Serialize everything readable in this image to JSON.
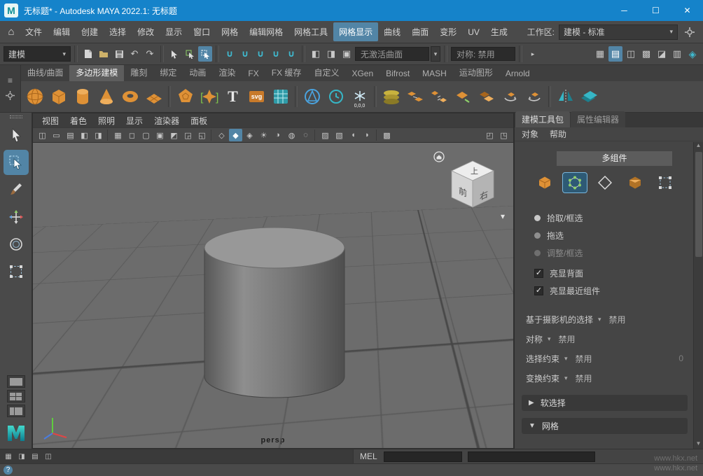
{
  "titlebar": {
    "title": "无标题* - Autodesk MAYA 2022.1: 无标题",
    "buttons": {
      "minimize": "─",
      "maximize": "☐",
      "close": "✕"
    }
  },
  "menubar": {
    "items": [
      "文件",
      "编辑",
      "创建",
      "选择",
      "修改",
      "显示",
      "窗口",
      "网格",
      "编辑网格",
      "网格工具",
      "网格显示",
      "曲线",
      "曲面",
      "变形",
      "UV",
      "生成"
    ],
    "active_item": "网格显示",
    "workspace_label": "工作区:",
    "workspace_value": "建模 - 标准"
  },
  "statusline": {
    "mode": "建模",
    "surface_field": "无激活曲面",
    "symmetry_field": "对称: 禁用",
    "icons": [
      "new-scene-icon",
      "open-scene-icon",
      "save-scene-icon",
      "undo-icon",
      "redo-icon",
      "select-hierarchy-icon",
      "select-object-icon",
      "select-component-icon",
      "snap-grid-icon",
      "snap-curve-icon",
      "snap-point-icon",
      "snap-plane-icon",
      "snap-view-icon",
      "input-connections-icon",
      "output-connections-icon",
      "construction-history-icon",
      "render-icon",
      "ipr-render-icon",
      "render-settings-icon"
    ]
  },
  "shelf": {
    "tabs": [
      "曲线/曲面",
      "多边形建模",
      "雕刻",
      "绑定",
      "动画",
      "渲染",
      "FX",
      "FX 缓存",
      "自定义",
      "XGen",
      "Bifrost",
      "MASH",
      "运动图形",
      "Arnold"
    ],
    "active_tab": "多边形建模",
    "icon_labels": {
      "type_tool": "T",
      "svg_tool": "svg",
      "origin_snap": "0,0,0"
    },
    "icons": [
      "poly-sphere-icon",
      "poly-cube-icon",
      "poly-cylinder-icon",
      "poly-cone-icon",
      "poly-torus-icon",
      "poly-plane-icon",
      "platonic-solid-icon",
      "super-shape-icon",
      "type-tool-icon",
      "svg-tool-icon",
      "sweep-mesh-icon",
      "construction-plane-icon",
      "make-live-icon",
      "origin-snap-icon",
      "combine-layers-icon",
      "combine-icon",
      "separate-icon",
      "extract-icon",
      "duplicate-face-icon",
      "rotate-cw-icon",
      "rotate-ccw-icon",
      "mirror-icon",
      "instance-sheets-icon"
    ]
  },
  "toolbox": {
    "tools": [
      "select-tool",
      "lasso-select-tool",
      "paint-select-tool",
      "move-tool",
      "rotate-tool",
      "scale-tool"
    ],
    "active_tool": "lasso-select-tool"
  },
  "viewport": {
    "menus": [
      "视图",
      "着色",
      "照明",
      "显示",
      "渲染器",
      "面板"
    ],
    "camera_label": "persp",
    "viewcube": {
      "top": "上",
      "front": "前",
      "right": "右"
    }
  },
  "right_panel": {
    "tabs": [
      "建模工具包",
      "属性编辑器"
    ],
    "active_tab": "建模工具包",
    "menus": [
      "对象",
      "帮助"
    ],
    "header": "多组件",
    "component_icons": [
      "object-mode-icon",
      "vertex-mode-icon",
      "edge-mode-icon",
      "face-mode-icon",
      "multi-select-icon"
    ],
    "active_component": "vertex-mode-icon",
    "radios": [
      {
        "label": "拾取/框选",
        "selected": true,
        "disabled": false
      },
      {
        "label": "拖选",
        "selected": false,
        "disabled": false
      },
      {
        "label": "调整/框选",
        "selected": false,
        "disabled": true
      }
    ],
    "checkboxes": [
      {
        "label": "亮显背面",
        "checked": true
      },
      {
        "label": "亮显最近组件",
        "checked": true
      }
    ],
    "option_rows": [
      {
        "label": "基于摄影机的选择",
        "value": "禁用",
        "extra": ""
      },
      {
        "label": "对称",
        "value": "禁用",
        "extra": ""
      },
      {
        "label": "选择约束",
        "value": "禁用",
        "extra": "0"
      },
      {
        "label": "变换约束",
        "value": "禁用",
        "extra": ""
      }
    ],
    "sections": [
      {
        "label": "软选择",
        "state": "collapsed"
      },
      {
        "label": "网格",
        "state": "expanded"
      }
    ]
  },
  "commandline": {
    "label": "MEL"
  },
  "watermark": {
    "line1": "www.hkx.net",
    "line2": "www.hkx.net"
  },
  "colors": {
    "titlebar": "#1583ca",
    "accent": "#5285a6",
    "shelf_orange": "#de9136",
    "teal": "#36b6c6",
    "viewport_bg": "#6c6c6c"
  }
}
